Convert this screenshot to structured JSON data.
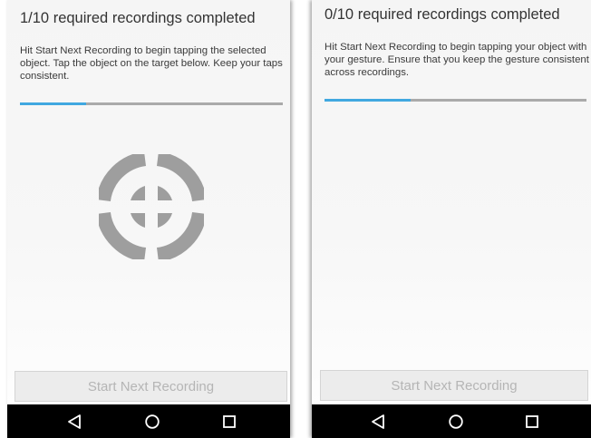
{
  "left_screen": {
    "title": "1/10 required recordings completed",
    "instructions": "Hit Start Next Recording to begin tapping the selected object. Tap the object on the target below. Keep your taps consistent.",
    "progress_fraction": 0.25,
    "target_icon": "crosshair-target-icon",
    "start_button_label": "Start Next Recording",
    "start_button_enabled": false
  },
  "right_screen": {
    "title": "0/10 required recordings completed",
    "instructions": "Hit Start Next Recording to begin tapping your object with your gesture. Ensure that you keep the gesture consistent across recordings.",
    "progress_fraction": 0.33,
    "start_button_label": "Start Next Recording",
    "start_button_enabled": false
  },
  "nav_bar": {
    "icons": [
      "back-icon",
      "home-icon",
      "recents-icon"
    ]
  },
  "colors": {
    "progress_fill": "#41a8e0",
    "progress_track": "#aaaaaa",
    "target": "#9e9e9e",
    "button_text_disabled": "#b5b5b5",
    "nav_bar": "#000000"
  }
}
